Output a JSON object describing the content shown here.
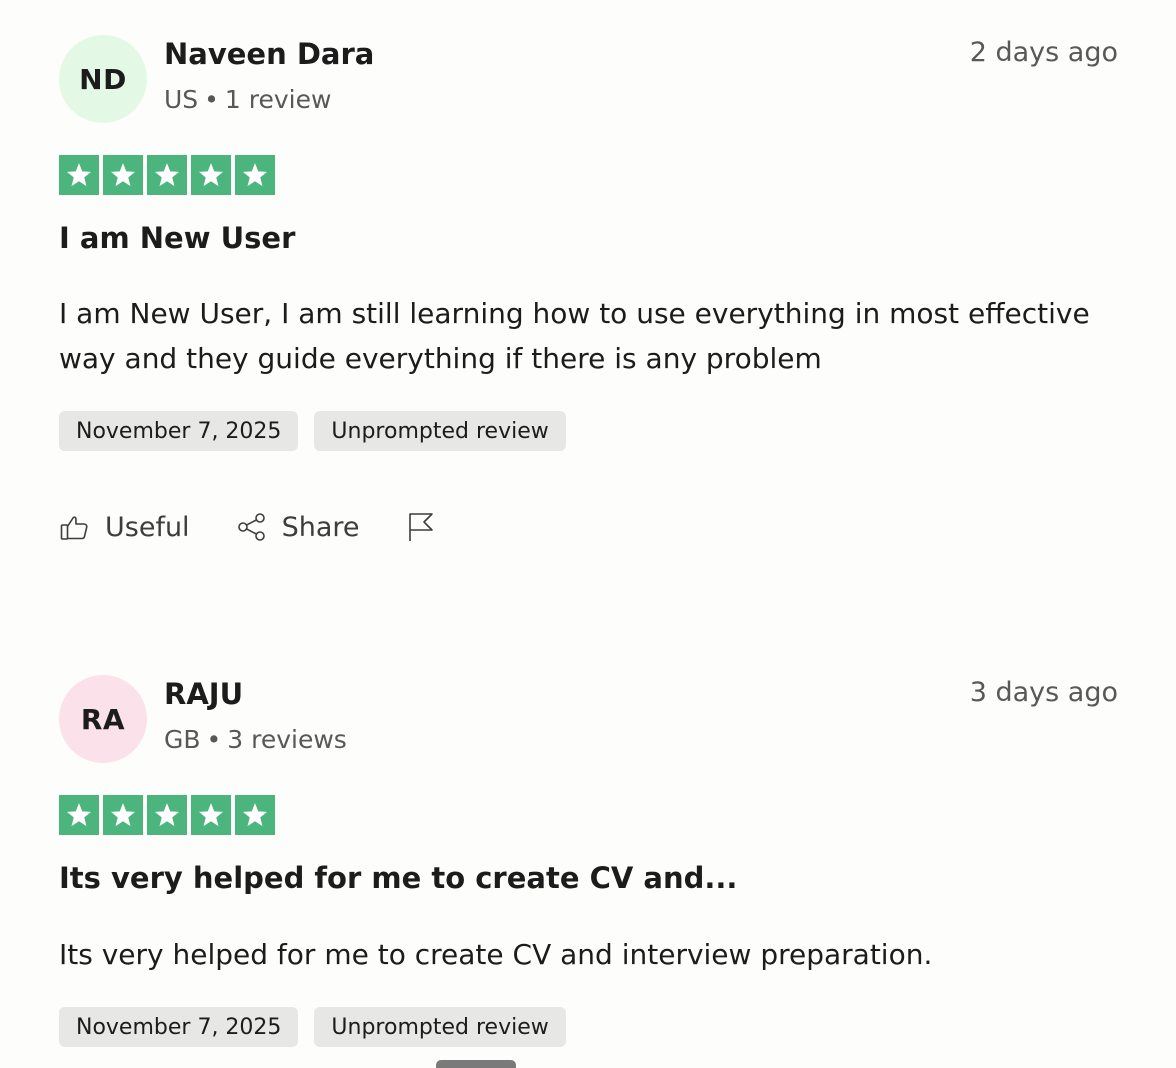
{
  "reviews": [
    {
      "avatar_initials": "ND",
      "avatar_color": "#e3f9e5",
      "name": "Naveen Dara",
      "country": "US",
      "review_count": "1 review",
      "time_ago": "2 days ago",
      "rating": 5,
      "star_color": "#4cb57e",
      "title": "I am New User",
      "body": "I am New User, I am still learning how to use everything in most effective way and they guide everything if there is any problem",
      "date": "November 7, 2025",
      "tag": "Unprompted review",
      "useful_label": "Useful",
      "share_label": "Share"
    },
    {
      "avatar_initials": "RA",
      "avatar_color": "#fbe1ea",
      "name": "RAJU",
      "country": "GB",
      "review_count": "3 reviews",
      "time_ago": "3 days ago",
      "rating": 5,
      "star_color": "#4cb57e",
      "title": "Its very helped for me to create CV and...",
      "body": "Its very helped for me to create CV and interview preparation.",
      "date": "November 7, 2025",
      "tag": "Unprompted review"
    }
  ]
}
